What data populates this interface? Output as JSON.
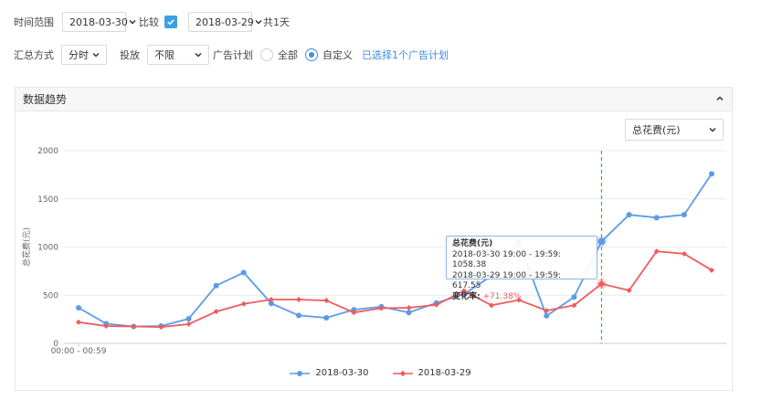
{
  "filters": {
    "time_range_label": "时间范围",
    "date_start": "2018-03-30",
    "compare_label": "比较",
    "compare_checked": true,
    "date_compare": "2018-03-29",
    "total_days": "共1天",
    "aggregate_label": "汇总方式",
    "aggregate_value": "分时",
    "delivery_label": "投放",
    "delivery_value": "不限",
    "ad_plan_label": "广告计划",
    "radio_all": "全部",
    "radio_custom": "自定义",
    "selected_plans_link": "已选择1个广告计划"
  },
  "panel": {
    "title": "数据趋势",
    "metric_select": "总花费(元)"
  },
  "colors": {
    "series1": "#5b9be8",
    "series2": "#ef5b5b",
    "accent": "#3aa0e3",
    "marker_line": "#4caf50"
  },
  "chart_data": {
    "type": "line",
    "ylabel": "总花费(元)",
    "ylim": [
      0,
      2000
    ],
    "yticks": [
      "0",
      "500",
      "1000",
      "1500",
      "2000"
    ],
    "x_tick_label": "00:00 - 00:59",
    "x": [
      0,
      1,
      2,
      3,
      4,
      5,
      6,
      7,
      8,
      9,
      10,
      11,
      12,
      13,
      14,
      15,
      16,
      17,
      18,
      19,
      20,
      21,
      22,
      23
    ],
    "series": [
      {
        "name": "2018-03-30",
        "values": [
          370,
          205,
          175,
          180,
          255,
          600,
          735,
          415,
          290,
          265,
          350,
          380,
          320,
          420,
          510,
          700,
          1050,
          285,
          480,
          1058.38,
          1335,
          1305,
          1335,
          1760
        ]
      },
      {
        "name": "2018-03-29",
        "values": [
          220,
          180,
          175,
          170,
          200,
          330,
          410,
          455,
          455,
          445,
          320,
          365,
          370,
          400,
          545,
          395,
          450,
          340,
          395,
          617.55,
          550,
          955,
          930,
          760
        ]
      }
    ],
    "highlight_index": 19,
    "tooltip": {
      "title": "总花费(元)",
      "line1": "2018-03-30 19:00 - 19:59: 1058.38",
      "line2": "2018-03-29 19:00 - 19:59: 617.55",
      "change_key": "变化率:",
      "change_value": "+71.38%"
    }
  }
}
